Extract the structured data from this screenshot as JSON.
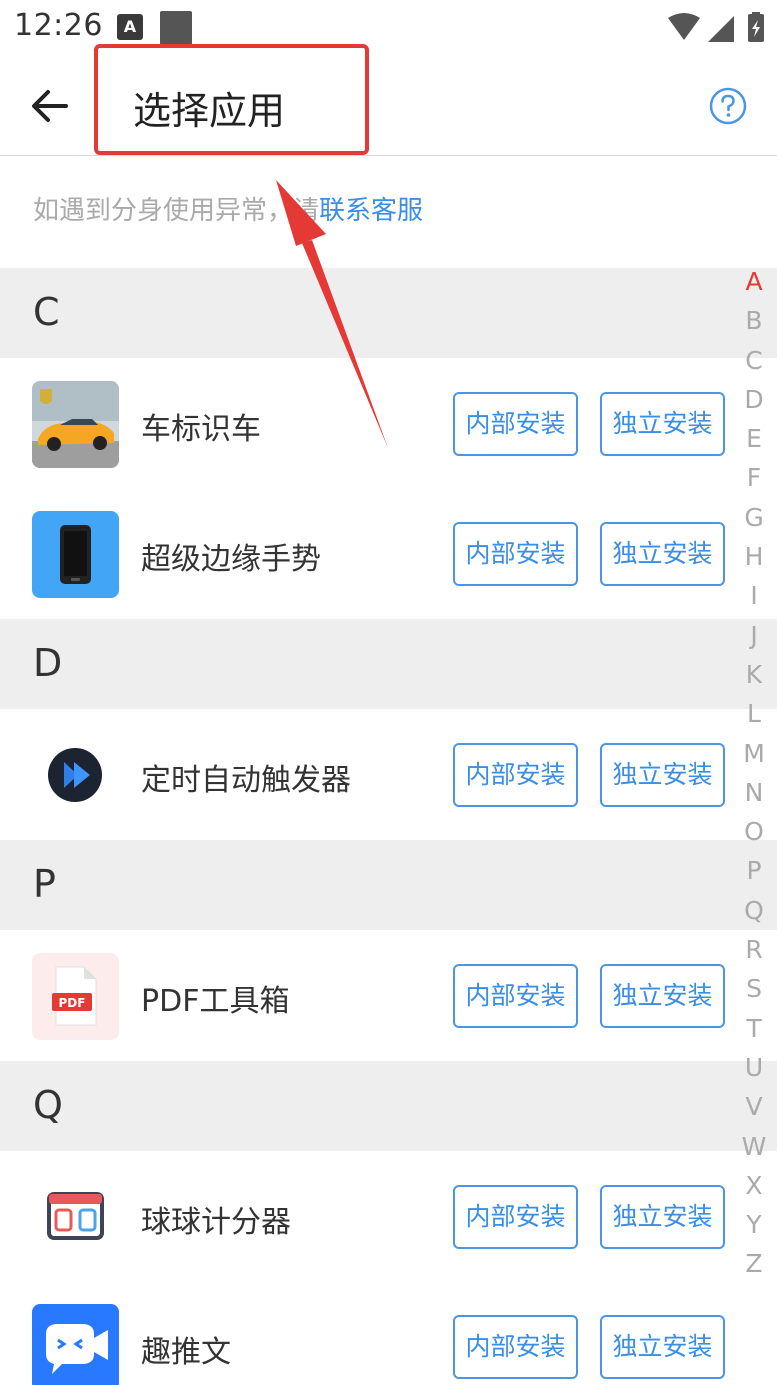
{
  "status_bar": {
    "time": "12:26",
    "notif_letter": "A"
  },
  "toolbar": {
    "title": "选择应用"
  },
  "notice": {
    "text": "如遇到分身使用异常，请",
    "link": "联系客服"
  },
  "buttons": {
    "internal": "内部安装",
    "independent": "独立安装"
  },
  "sections": [
    {
      "letter": "C",
      "apps": [
        {
          "name": "车标识车",
          "icon": "car-photo-icon"
        },
        {
          "name": "超级边缘手势",
          "icon": "phone-icon"
        }
      ]
    },
    {
      "letter": "D",
      "apps": [
        {
          "name": "定时自动触发器",
          "icon": "play-timer-icon"
        }
      ]
    },
    {
      "letter": "P",
      "apps": [
        {
          "name": "PDF工具箱",
          "icon": "pdf-file-icon"
        }
      ]
    },
    {
      "letter": "Q",
      "apps": [
        {
          "name": "球球计分器",
          "icon": "scoreboard-icon"
        },
        {
          "name": "趣推文",
          "icon": "chat-bubble-icon"
        }
      ]
    }
  ],
  "index_letters": [
    "A",
    "B",
    "C",
    "D",
    "E",
    "F",
    "G",
    "H",
    "I",
    "J",
    "K",
    "L",
    "M",
    "N",
    "O",
    "P",
    "Q",
    "R",
    "S",
    "T",
    "U",
    "V",
    "W",
    "X",
    "Y",
    "Z"
  ],
  "active_index": "A",
  "colors": {
    "accent": "#3a8ee6",
    "annotation": "#e53935",
    "section_bg": "#eeeeee"
  }
}
